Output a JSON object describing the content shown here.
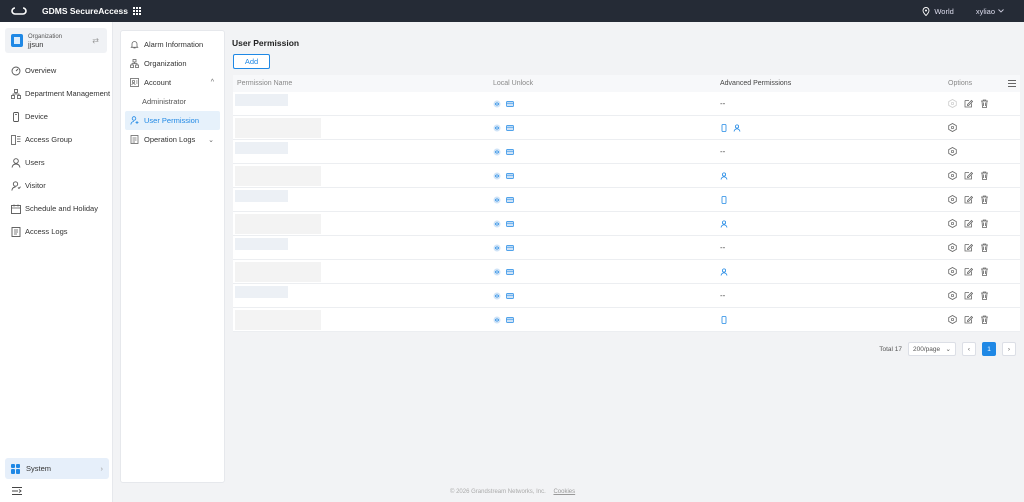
{
  "header": {
    "app_title": "GDMS SecureAccess",
    "region": "World",
    "user": "xyliao"
  },
  "organization": {
    "label": "Organization",
    "value": "jjsun"
  },
  "sidebar": {
    "items": [
      {
        "label": "Overview",
        "icon": "dashboard-icon"
      },
      {
        "label": "Department Management",
        "icon": "org-tree-icon"
      },
      {
        "label": "Device",
        "icon": "device-icon"
      },
      {
        "label": "Access Group",
        "icon": "access-group-icon"
      },
      {
        "label": "Users",
        "icon": "user-icon"
      },
      {
        "label": "Visitor",
        "icon": "visitor-icon"
      },
      {
        "label": "Schedule and Holiday",
        "icon": "calendar-icon"
      },
      {
        "label": "Access Logs",
        "icon": "log-icon"
      }
    ],
    "system": "System"
  },
  "submenu": {
    "alarm": "Alarm Information",
    "organization": "Organization",
    "account": "Account",
    "administrator": "Administrator",
    "user_permission": "User Permission",
    "operation_logs": "Operation Logs"
  },
  "main": {
    "title": "User Permission",
    "add_label": "Add",
    "columns": [
      "Permission Name",
      "Local Unlock",
      "Advanced Permissions",
      "Options"
    ],
    "rows": [
      {
        "advanced": "none",
        "actions": "disabled"
      },
      {
        "advanced": "phone+user",
        "actions": "view"
      },
      {
        "advanced": "none",
        "actions": "view"
      },
      {
        "advanced": "user",
        "actions": "full"
      },
      {
        "advanced": "phone",
        "actions": "full"
      },
      {
        "advanced": "user",
        "actions": "full"
      },
      {
        "advanced": "none",
        "actions": "full"
      },
      {
        "advanced": "user",
        "actions": "full"
      },
      {
        "advanced": "none",
        "actions": "full"
      },
      {
        "advanced": "phone",
        "actions": "full"
      }
    ],
    "dash": "--"
  },
  "pagination": {
    "total": "Total 17",
    "page_size": "200/page",
    "current_page": "1"
  },
  "footer": {
    "copyright": "© 2026 Grandstream Networks, Inc.",
    "cookies": "Cookies"
  },
  "colors": {
    "accent": "#1f88e5",
    "topbar": "#252b36"
  }
}
